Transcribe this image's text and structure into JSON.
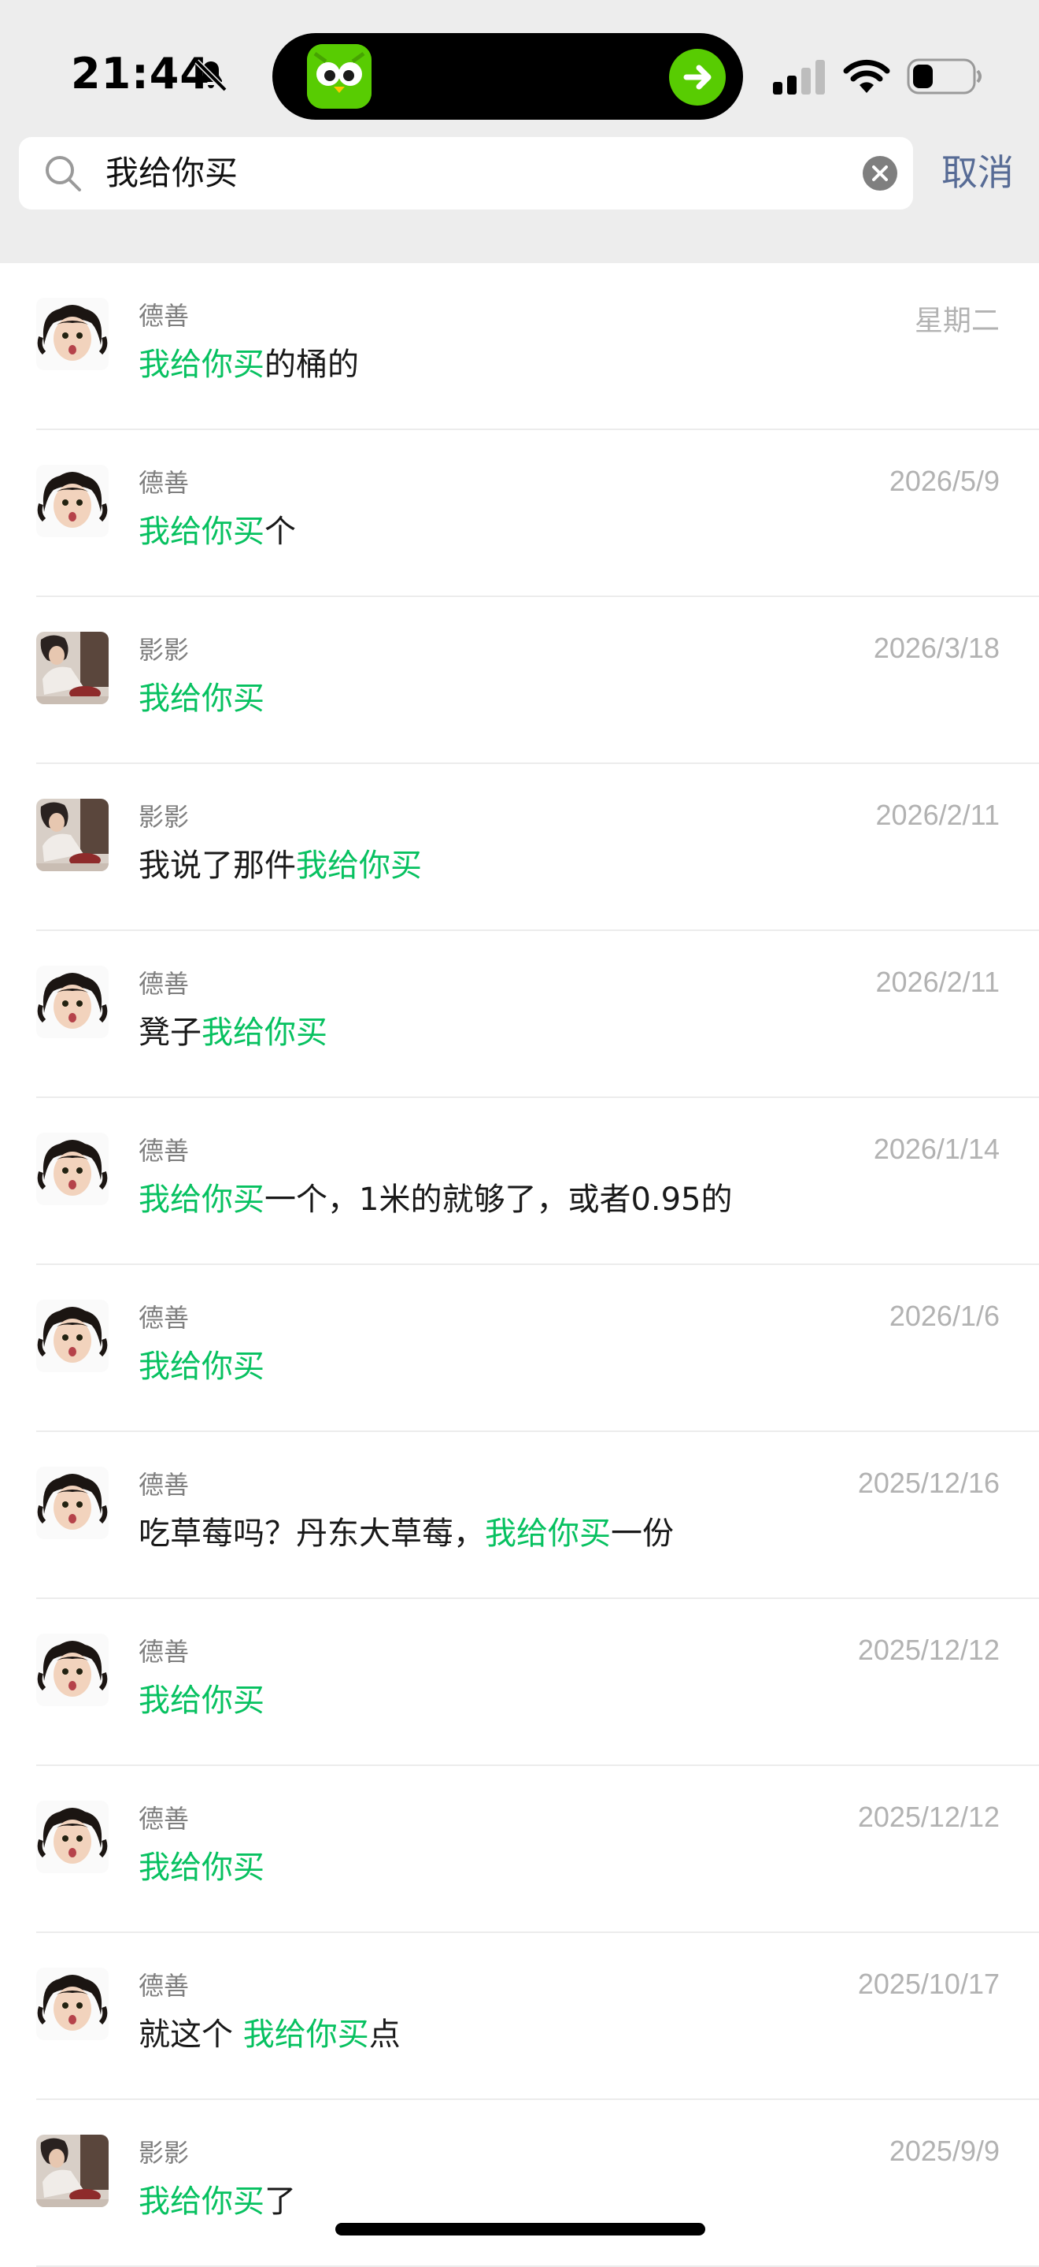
{
  "status_bar": {
    "time": "21:44",
    "icons": [
      "bell-slash-icon",
      "duolingo-app-icon",
      "arrow-right-icon",
      "cellular-signal-icon",
      "wifi-icon",
      "battery-icon"
    ],
    "battery_level": 0.35,
    "accent_color": "#58cc02"
  },
  "search": {
    "query": "我给你买",
    "cancel_label": "取消",
    "highlight_color": "#07c160"
  },
  "results": [
    {
      "avatar": "girl-avatar",
      "name": "德善",
      "date": "星期二",
      "before": "",
      "match": "我给你买",
      "after": "的桶的"
    },
    {
      "avatar": "girl-avatar",
      "name": "德善",
      "date": "2026/5/9",
      "before": "",
      "match": "我给你买",
      "after": "个"
    },
    {
      "avatar": "photo-avatar",
      "name": "影影",
      "date": "2026/3/18",
      "before": "",
      "match": "我给你买",
      "after": ""
    },
    {
      "avatar": "photo-avatar",
      "name": "影影",
      "date": "2026/2/11",
      "before": "我说了那件",
      "match": "我给你买",
      "after": ""
    },
    {
      "avatar": "girl-avatar",
      "name": "德善",
      "date": "2026/2/11",
      "before": "凳子",
      "match": "我给你买",
      "after": ""
    },
    {
      "avatar": "girl-avatar",
      "name": "德善",
      "date": "2026/1/14",
      "before": "",
      "match": "我给你买",
      "after": "一个，1米的就够了，或者0.95的"
    },
    {
      "avatar": "girl-avatar",
      "name": "德善",
      "date": "2026/1/6",
      "before": "",
      "match": "我给你买",
      "after": ""
    },
    {
      "avatar": "girl-avatar",
      "name": "德善",
      "date": "2025/12/16",
      "before": "吃草莓吗？丹东大草莓，",
      "match": "我给你买",
      "after": "一份"
    },
    {
      "avatar": "girl-avatar",
      "name": "德善",
      "date": "2025/12/12",
      "before": "",
      "match": "我给你买",
      "after": ""
    },
    {
      "avatar": "girl-avatar",
      "name": "德善",
      "date": "2025/12/12",
      "before": "",
      "match": "我给你买",
      "after": ""
    },
    {
      "avatar": "girl-avatar",
      "name": "德善",
      "date": "2025/10/17",
      "before": "就这个 ",
      "match": "我给你买",
      "after": "点"
    },
    {
      "avatar": "photo-avatar",
      "name": "影影",
      "date": "2025/9/9",
      "before": "",
      "match": "我给你买",
      "after": "了"
    }
  ]
}
